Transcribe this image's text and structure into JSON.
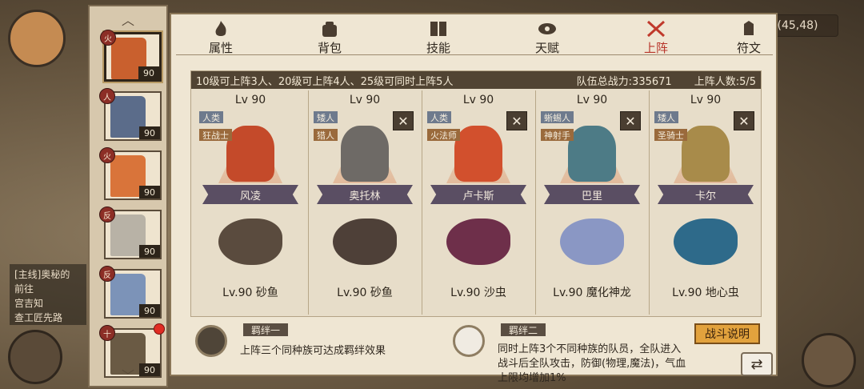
{
  "background": {
    "coords": "(45,48)",
    "quest_lines": [
      "[主线]奥秘的",
      "前往",
      "宫吉知",
      "查工匠先路"
    ]
  },
  "roster": {
    "heroes": [
      {
        "level": "90",
        "badge": "火",
        "color": "#c9602e",
        "selected": true
      },
      {
        "level": "90",
        "badge": "人",
        "color": "#5b6c8a"
      },
      {
        "level": "90",
        "badge": "火",
        "color": "#d9743a"
      },
      {
        "level": "90",
        "badge": "反",
        "color": "#b8b2a6"
      },
      {
        "level": "90",
        "badge": "反",
        "color": "#7c93b8"
      },
      {
        "level": "90",
        "badge": "十",
        "color": "#6a5a44"
      }
    ]
  },
  "tabs": [
    {
      "label": "属性",
      "icon": "fire-icon"
    },
    {
      "label": "背包",
      "icon": "bag-icon"
    },
    {
      "label": "技能",
      "icon": "book-icon"
    },
    {
      "label": "天赋",
      "icon": "eye-icon"
    },
    {
      "label": "上阵",
      "icon": "crossed-swords-icon",
      "active": true
    },
    {
      "label": "符文",
      "icon": "rune-icon"
    }
  ],
  "info_bar": {
    "rule": "10级可上阵3人、20级可上阵4人、25级可同时上阵5人",
    "power_label": "队伍总战力:335671",
    "count_label": "上阵人数:5/5"
  },
  "slots": [
    {
      "level": "Lv 90",
      "race": "人类",
      "cls": "狂战士",
      "name": "风凌",
      "pet": "Lv.90 砂鱼",
      "removable": false,
      "hero_color": "#c44a2a",
      "pet_color": "#5a4b3e"
    },
    {
      "level": "Lv 90",
      "race": "矮人",
      "cls": "猎人",
      "name": "奥托林",
      "pet": "Lv.90 砂鱼",
      "removable": true,
      "hero_color": "#6e6a66",
      "pet_color": "#4e4038"
    },
    {
      "level": "Lv 90",
      "race": "人类",
      "cls": "火法师",
      "name": "卢卡斯",
      "pet": "Lv.90 沙虫",
      "removable": true,
      "hero_color": "#d2502d",
      "pet_color": "#6e2f4a"
    },
    {
      "level": "Lv 90",
      "race": "蜥蜴人",
      "cls": "神射手",
      "name": "巴里",
      "pet": "Lv.90 魔化神龙",
      "removable": true,
      "hero_color": "#4d7b86",
      "pet_color": "#8a97c4"
    },
    {
      "level": "Lv 90",
      "race": "矮人",
      "cls": "圣骑士",
      "name": "卡尔",
      "pet": "Lv.90 地心虫",
      "removable": true,
      "hero_color": "#a88b4a",
      "pet_color": "#2e6a8a"
    }
  ],
  "bonds": [
    {
      "title": "羁绊一",
      "desc": "上阵三个同种族可达成羁绊效果"
    },
    {
      "title": "羁绊二",
      "desc": "同时上阵3个不同种族的队员，全队进入战斗后全队攻击，防御(物理,魔法)，气血上限均增加1%"
    }
  ],
  "buttons": {
    "battle_help": "战斗说明",
    "remove": "✕",
    "swap": "⇄"
  }
}
